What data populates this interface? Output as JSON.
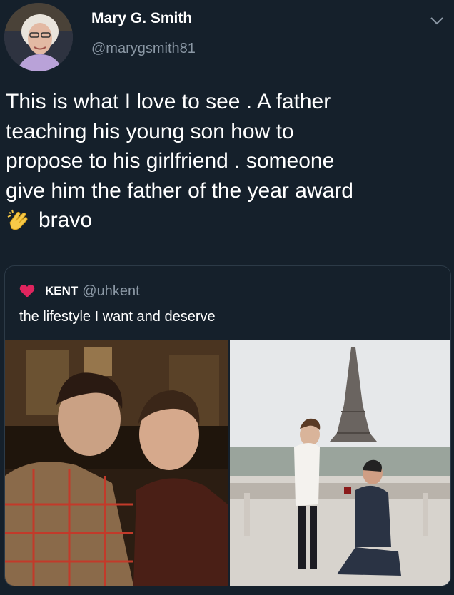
{
  "tweet": {
    "author_name": "Mary G. Smith",
    "author_handle": "@marygsmith81",
    "text_lines": [
      "This is what I love to see . A father",
      "teaching his young son how to",
      "propose to his girlfriend . someone",
      "give him the father of the year award"
    ],
    "text_last": "bravo",
    "clap_icon": "clapping-hands-icon",
    "menu_icon": "chevron-down-icon"
  },
  "quote": {
    "author_name": "KENT",
    "author_handle": "@uhkent",
    "text": "the lifestyle I want and deserve",
    "badge_icon": "heart-icon"
  },
  "colors": {
    "background": "#15202b",
    "text": "#ffffff",
    "secondary_text": "#8b98a5",
    "heart": "#e0245e"
  }
}
